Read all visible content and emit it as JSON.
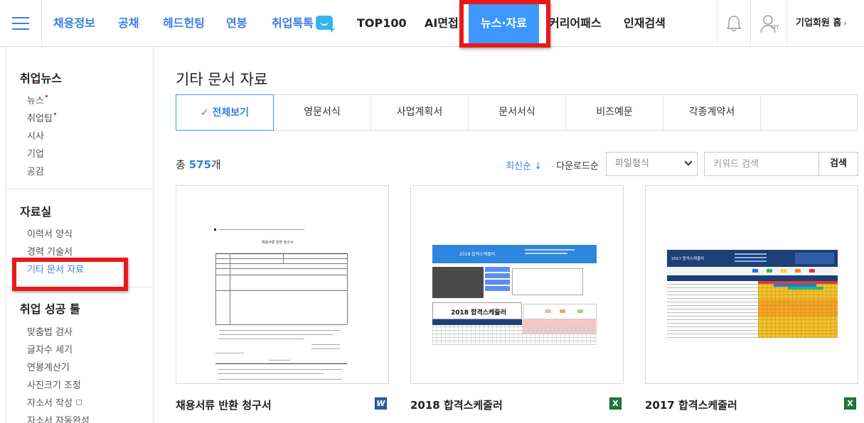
{
  "nav": {
    "items": [
      "채용정보",
      "공채",
      "헤드헌팅",
      "연봉",
      "취업톡톡",
      "TOP100",
      "AI면접",
      "뉴스·자료",
      "커리어패스",
      "인재검색"
    ],
    "my_label": "MY",
    "corp_home": "기업회원 홈"
  },
  "sidebar": {
    "news_title": "취업뉴스",
    "news_items": [
      "뉴스",
      "취업팁",
      "시사",
      "기업",
      "공감"
    ],
    "data_title": "자료실",
    "data_items": [
      "이력서 양식",
      "경력 기술서",
      "기타 문서 자료"
    ],
    "tools_title": "취업 성공 툴",
    "tools_items": [
      "맞춤법 검사",
      "글자수 세기",
      "연봉계산기",
      "사진크기 조정",
      "자소서 작성",
      "자소서 자동완성"
    ]
  },
  "main": {
    "title": "기타 문서 자료",
    "tabs": [
      "전체보기",
      "영문서식",
      "사업계획서",
      "문서서식",
      "비즈예문",
      "각종계약서"
    ],
    "total_prefix": "총 ",
    "total_count": "575",
    "total_suffix": "개",
    "sort_latest": "최신순 ↓",
    "sort_downloads": "다운로드순",
    "file_type_select": "파일형식",
    "keyword_placeholder": "키워드 검색",
    "search_button": "검색"
  },
  "cards": [
    {
      "title": "채용서류 반환 청구서",
      "file_type": "word",
      "file_icon_label": "W"
    },
    {
      "title": "2018 합격스케줄러",
      "file_type": "excel",
      "file_icon_label": "X"
    },
    {
      "title": "2017 합격스케줄러",
      "file_type": "excel",
      "file_icon_label": "X"
    }
  ],
  "thumbnails": {
    "doc_title": "채용서류 반환 청구서",
    "sheet1_banner": "2018 합격스케줄러",
    "sheet1_title": "2018 합격스케줄러",
    "sheet2_title": "2017 합격스케줄러"
  },
  "colors": {
    "accent": "#3d97ff",
    "nav_blue": "#3a7de3",
    "highlight_red": "#e8191a"
  }
}
